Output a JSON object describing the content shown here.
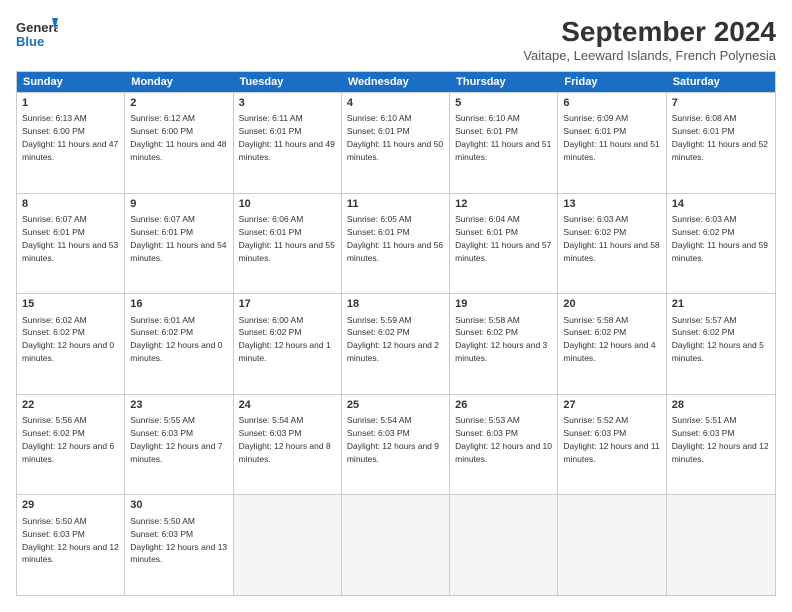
{
  "logo": {
    "general": "General",
    "blue": "Blue"
  },
  "title": "September 2024",
  "location": "Vaitape, Leeward Islands, French Polynesia",
  "days": [
    "Sunday",
    "Monday",
    "Tuesday",
    "Wednesday",
    "Thursday",
    "Friday",
    "Saturday"
  ],
  "weeks": [
    [
      {
        "day": 1,
        "sunrise": "6:13 AM",
        "sunset": "6:00 PM",
        "daylight": "11 hours and 47 minutes."
      },
      {
        "day": 2,
        "sunrise": "6:12 AM",
        "sunset": "6:00 PM",
        "daylight": "11 hours and 48 minutes."
      },
      {
        "day": 3,
        "sunrise": "6:11 AM",
        "sunset": "6:01 PM",
        "daylight": "11 hours and 49 minutes."
      },
      {
        "day": 4,
        "sunrise": "6:10 AM",
        "sunset": "6:01 PM",
        "daylight": "11 hours and 50 minutes."
      },
      {
        "day": 5,
        "sunrise": "6:10 AM",
        "sunset": "6:01 PM",
        "daylight": "11 hours and 51 minutes."
      },
      {
        "day": 6,
        "sunrise": "6:09 AM",
        "sunset": "6:01 PM",
        "daylight": "11 hours and 51 minutes."
      },
      {
        "day": 7,
        "sunrise": "6:08 AM",
        "sunset": "6:01 PM",
        "daylight": "11 hours and 52 minutes."
      }
    ],
    [
      {
        "day": 8,
        "sunrise": "6:07 AM",
        "sunset": "6:01 PM",
        "daylight": "11 hours and 53 minutes."
      },
      {
        "day": 9,
        "sunrise": "6:07 AM",
        "sunset": "6:01 PM",
        "daylight": "11 hours and 54 minutes."
      },
      {
        "day": 10,
        "sunrise": "6:06 AM",
        "sunset": "6:01 PM",
        "daylight": "11 hours and 55 minutes."
      },
      {
        "day": 11,
        "sunrise": "6:05 AM",
        "sunset": "6:01 PM",
        "daylight": "11 hours and 56 minutes."
      },
      {
        "day": 12,
        "sunrise": "6:04 AM",
        "sunset": "6:01 PM",
        "daylight": "11 hours and 57 minutes."
      },
      {
        "day": 13,
        "sunrise": "6:03 AM",
        "sunset": "6:02 PM",
        "daylight": "11 hours and 58 minutes."
      },
      {
        "day": 14,
        "sunrise": "6:03 AM",
        "sunset": "6:02 PM",
        "daylight": "11 hours and 59 minutes."
      }
    ],
    [
      {
        "day": 15,
        "sunrise": "6:02 AM",
        "sunset": "6:02 PM",
        "daylight": "12 hours and 0 minutes."
      },
      {
        "day": 16,
        "sunrise": "6:01 AM",
        "sunset": "6:02 PM",
        "daylight": "12 hours and 0 minutes."
      },
      {
        "day": 17,
        "sunrise": "6:00 AM",
        "sunset": "6:02 PM",
        "daylight": "12 hours and 1 minute."
      },
      {
        "day": 18,
        "sunrise": "5:59 AM",
        "sunset": "6:02 PM",
        "daylight": "12 hours and 2 minutes."
      },
      {
        "day": 19,
        "sunrise": "5:58 AM",
        "sunset": "6:02 PM",
        "daylight": "12 hours and 3 minutes."
      },
      {
        "day": 20,
        "sunrise": "5:58 AM",
        "sunset": "6:02 PM",
        "daylight": "12 hours and 4 minutes."
      },
      {
        "day": 21,
        "sunrise": "5:57 AM",
        "sunset": "6:02 PM",
        "daylight": "12 hours and 5 minutes."
      }
    ],
    [
      {
        "day": 22,
        "sunrise": "5:56 AM",
        "sunset": "6:02 PM",
        "daylight": "12 hours and 6 minutes."
      },
      {
        "day": 23,
        "sunrise": "5:55 AM",
        "sunset": "6:03 PM",
        "daylight": "12 hours and 7 minutes."
      },
      {
        "day": 24,
        "sunrise": "5:54 AM",
        "sunset": "6:03 PM",
        "daylight": "12 hours and 8 minutes."
      },
      {
        "day": 25,
        "sunrise": "5:54 AM",
        "sunset": "6:03 PM",
        "daylight": "12 hours and 9 minutes."
      },
      {
        "day": 26,
        "sunrise": "5:53 AM",
        "sunset": "6:03 PM",
        "daylight": "12 hours and 10 minutes."
      },
      {
        "day": 27,
        "sunrise": "5:52 AM",
        "sunset": "6:03 PM",
        "daylight": "12 hours and 11 minutes."
      },
      {
        "day": 28,
        "sunrise": "5:51 AM",
        "sunset": "6:03 PM",
        "daylight": "12 hours and 12 minutes."
      }
    ],
    [
      {
        "day": 29,
        "sunrise": "5:50 AM",
        "sunset": "6:03 PM",
        "daylight": "12 hours and 12 minutes."
      },
      {
        "day": 30,
        "sunrise": "5:50 AM",
        "sunset": "6:03 PM",
        "daylight": "12 hours and 13 minutes."
      },
      null,
      null,
      null,
      null,
      null
    ]
  ]
}
